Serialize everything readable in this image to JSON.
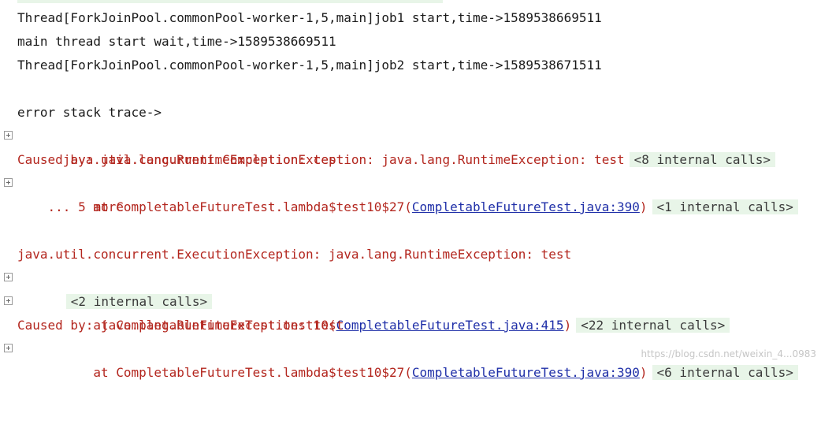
{
  "console": {
    "lines": [
      {
        "text": "Thread[ForkJoinPool.commonPool-worker-1,5,main]job1 start,time->1589538669511"
      },
      {
        "text": "main thread start wait,time->1589538669511"
      },
      {
        "text": "Thread[ForkJoinPool.commonPool-worker-1,5,main]job2 start,time->1589538671511"
      },
      {
        "text": ""
      },
      {
        "text": "error stack trace->"
      },
      {
        "text": "java.util.concurrent.CompletionException: java.lang.RuntimeException: test",
        "fold": "<8 internal calls>"
      },
      {
        "text": "Caused by: java.lang.RuntimeException: test"
      },
      {
        "text": "    at CompletableFutureTest.lambda$test10$27(",
        "link": "CompletableFutureTest.java:390",
        "after": ")",
        "fold": "<1 internal calls>"
      },
      {
        "text": "    ... 5 more"
      },
      {
        "text": ""
      },
      {
        "text": "java.util.concurrent.ExecutionException: java.lang.RuntimeException: test"
      },
      {
        "text": "",
        "fold": "<2 internal calls>"
      },
      {
        "text": "    at CompletableFutureTest.test10(",
        "link": "CompletableFutureTest.java:415",
        "after": ")",
        "fold": "<22 internal calls>"
      },
      {
        "text": "Caused by: java.lang.RuntimeException: test"
      },
      {
        "text": "    at CompletableFutureTest.lambda$test10$27(",
        "link": "CompletableFutureTest.java:390",
        "after": ")",
        "fold": "<6 internal calls>"
      }
    ]
  },
  "watermark": "https://blog.csdn.net/weixin_4...0983"
}
